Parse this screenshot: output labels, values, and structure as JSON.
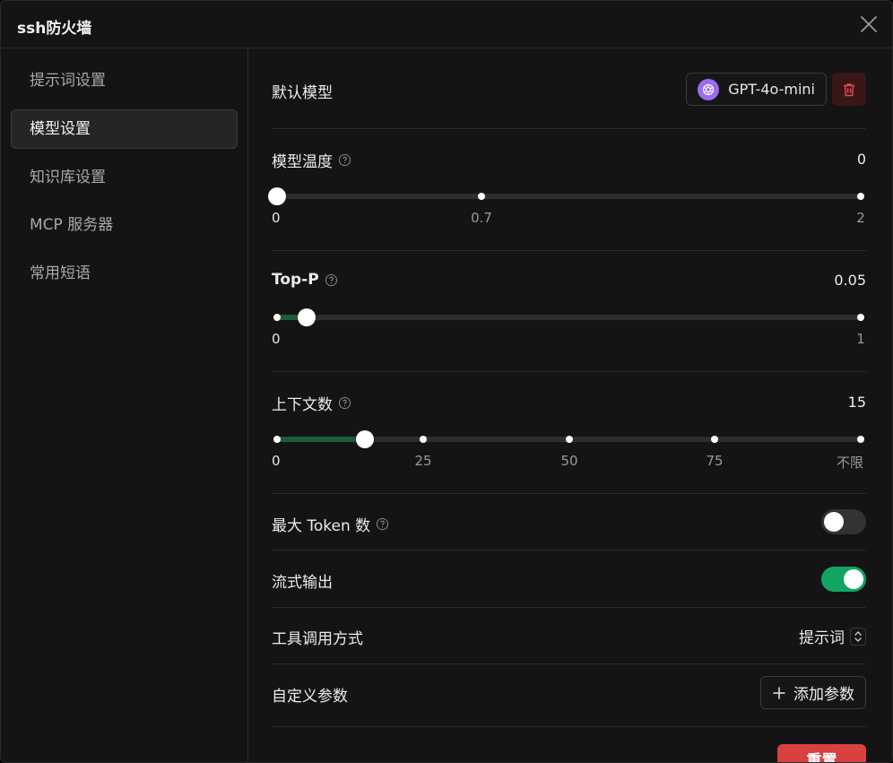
{
  "window": {
    "title": "ssh防火墙"
  },
  "sidebar": {
    "items": [
      {
        "label": "提示词设置"
      },
      {
        "label": "模型设置"
      },
      {
        "label": "知识库设置"
      },
      {
        "label": "MCP 服务器"
      },
      {
        "label": "常用短语"
      }
    ]
  },
  "default_model": {
    "label": "默认模型",
    "model_name": "GPT-4o-mini",
    "logo_icon": "openai-icon",
    "delete_icon": "trash-icon"
  },
  "temperature": {
    "label": "模型温度",
    "value": "0",
    "level": 0,
    "ticks": [
      "0",
      "0.7",
      "2"
    ]
  },
  "top_p": {
    "label": "Top-P",
    "value": "0.05",
    "level": 0.05,
    "ticks": [
      "0",
      "1"
    ]
  },
  "context": {
    "label": "上下文数",
    "value": "15",
    "level": 0.15,
    "ticks": [
      "0",
      "25",
      "50",
      "75",
      "不限"
    ]
  },
  "max_tokens": {
    "label": "最大 Token 数",
    "enabled": false
  },
  "stream_output": {
    "label": "流式输出",
    "enabled": true
  },
  "tool_call": {
    "label": "工具调用方式",
    "value": "提示词"
  },
  "custom_params": {
    "label": "自定义参数",
    "add_label": "添加参数"
  },
  "reset": {
    "label": "重置"
  },
  "colors": {
    "accent": "#11a561",
    "danger": "#d94040",
    "slider_fill": "#1e5c3a"
  }
}
